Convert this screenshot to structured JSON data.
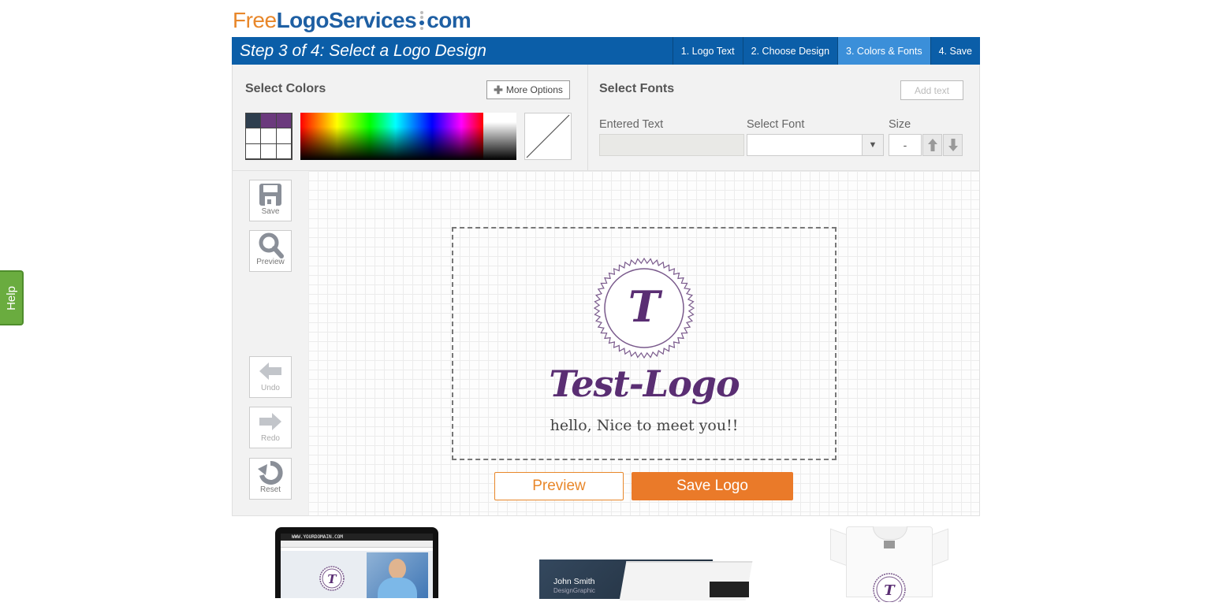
{
  "help_tab": {
    "label": "Help"
  },
  "brand": {
    "free": "Free",
    "logo": "LogoServices",
    "com": "com"
  },
  "stepbar": {
    "title": "Step 3 of 4: Select a Logo Design",
    "steps": [
      {
        "label": "1. Logo Text",
        "active": false
      },
      {
        "label": "2. Choose Design",
        "active": false
      },
      {
        "label": "3. Colors & Fonts",
        "active": true
      },
      {
        "label": "4. Save",
        "active": false
      }
    ]
  },
  "colors_panel": {
    "heading": "Select Colors",
    "more_options": "More Options",
    "swatches": [
      "#2e3e4e",
      "#6b3a7d",
      "#6b3a7d",
      "#ffffff",
      "#ffffff",
      "#ffffff",
      "#ffffff",
      "#ffffff",
      "#ffffff"
    ]
  },
  "fonts_panel": {
    "heading": "Select Fonts",
    "add_text": "Add text",
    "entered_text_label": "Entered Text",
    "select_font_label": "Select Font",
    "size_label": "Size",
    "size_value": "-",
    "entered_text_value": "",
    "font_value": ""
  },
  "tools": {
    "save": "Save",
    "preview": "Preview",
    "undo": "Undo",
    "redo": "Redo",
    "reset": "Reset"
  },
  "logo": {
    "monogram": "T",
    "main_text": "Test-Logo",
    "sub_text": "hello, Nice to meet you!!",
    "primary_color": "#5a2e73",
    "secondary_color": "#444444"
  },
  "actions": {
    "preview": "Preview",
    "save": "Save Logo"
  },
  "mockups": {
    "laptop_url": "WWW.YOURDOMAIN.COM",
    "card_name": "John Smith",
    "card_title": "DesignGraphic"
  },
  "colors": {
    "accent": "#ea7a29",
    "brand_blue": "#0b5ea8",
    "step_active": "#3b8fd9",
    "help_green": "#6aac3f"
  }
}
